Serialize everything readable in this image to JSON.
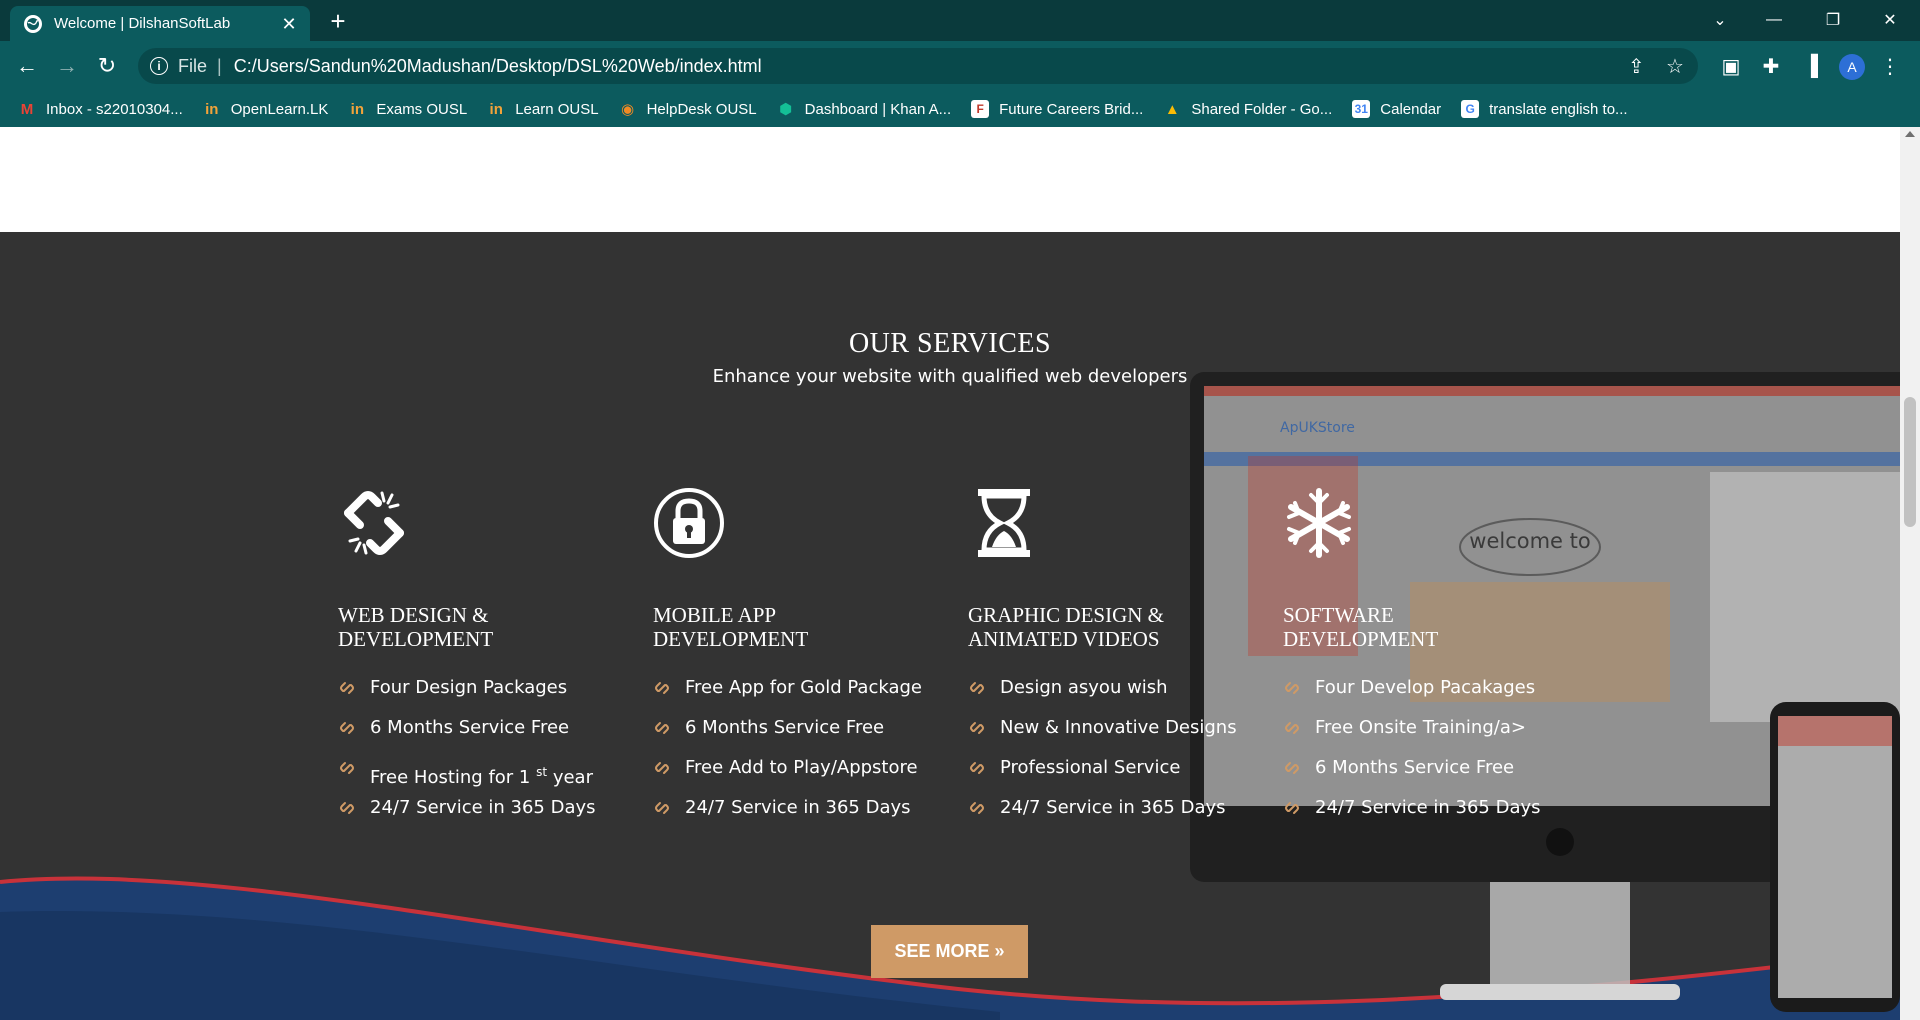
{
  "browser": {
    "tab_title": "Welcome | DilshanSoftLab",
    "address_scheme": "File",
    "address_url": "C:/Users/Sandun%20Madushan/Desktop/DSL%20Web/index.html",
    "profile_initial": "A",
    "bookmarks": [
      {
        "label": "Inbox - s22010304...",
        "icon": "gmail-icon"
      },
      {
        "label": "OpenLearn.LK",
        "icon": "ousl-icon"
      },
      {
        "label": "Exams OUSL",
        "icon": "ousl-icon"
      },
      {
        "label": "Learn OUSL",
        "icon": "ousl-icon"
      },
      {
        "label": "HelpDesk OUSL",
        "icon": "helpdesk-icon"
      },
      {
        "label": "Dashboard | Khan A...",
        "icon": "khan-academy-icon"
      },
      {
        "label": "Future Careers Brid...",
        "icon": "future-careers-icon"
      },
      {
        "label": "Shared Folder - Go...",
        "icon": "google-drive-icon"
      },
      {
        "label": "Calendar",
        "icon": "google-calendar-icon"
      },
      {
        "label": "translate english to...",
        "icon": "google-icon"
      }
    ]
  },
  "services": {
    "title": "OUR SERVICES",
    "subtitle": "Enhance your website with qualified web developers",
    "accent_color": "#cf9a66",
    "background_color": "#333333",
    "columns": [
      {
        "icon": "unlink-icon",
        "heading_line1": "WEB DESIGN &",
        "heading_line2": "DEVELOPMENT",
        "items": [
          "Four Design Packages",
          "6 Months Service Free",
          "Free Hosting for 1",
          "24/7 Service in 365 Days"
        ],
        "item3_sup": "st",
        "item3_tail": " year"
      },
      {
        "icon": "lock-icon",
        "heading_line1": "MOBILE APP",
        "heading_line2": "DEVELOPMENT",
        "items": [
          "Free App for Gold Package",
          "6 Months Service Free",
          "Free Add to Play/Appstore",
          "24/7 Service in 365 Days"
        ]
      },
      {
        "icon": "hourglass-icon",
        "heading_line1": "GRAPHIC DESIGN &",
        "heading_line2": "ANIMATED VIDEOS",
        "items": [
          "Design asyou wish",
          "New & Innovative Designs",
          "Professional Service",
          "24/7 Service in 365 Days"
        ]
      },
      {
        "icon": "snowflake-icon",
        "heading_line1": "SOFTWARE",
        "heading_line2": "DEVELOPMENT",
        "items": [
          "Four Develop Pacakages",
          "Free Onsite Training/a>",
          "6 Months Service Free",
          "24/7 Service in 365 Days"
        ]
      }
    ],
    "see_more_label": "SEE MORE »",
    "mockup": {
      "store_name": "ApUKStore",
      "banner_text": "welcome to"
    }
  }
}
